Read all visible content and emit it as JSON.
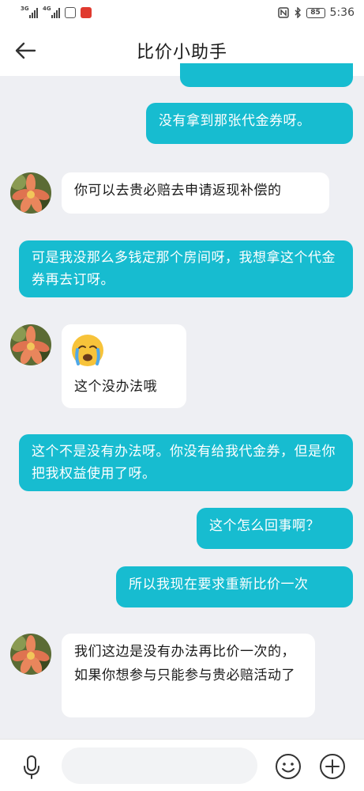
{
  "status_bar": {
    "network_1": "3G",
    "network_2": "4G",
    "battery": "85",
    "time": "5:36"
  },
  "header": {
    "title": "比价小助手"
  },
  "messages": [
    {
      "from": "me",
      "text": "没有拿到那张代金券呀。"
    },
    {
      "from": "bot",
      "text": "你可以去贵必赔去申请返现补偿的"
    },
    {
      "from": "me",
      "text": "可是我没那么多钱定那个房间呀，我想拿这个代金券再去订呀。"
    },
    {
      "from": "bot",
      "emoji": "😭",
      "text": "这个没办法哦"
    },
    {
      "from": "me",
      "text": "这个不是没有办法呀。你没有给我代金券，但是你把我权益使用了呀。"
    },
    {
      "from": "me",
      "text": "这个怎么回事啊？"
    },
    {
      "from": "me",
      "text": "所以我现在要求重新比价一次"
    },
    {
      "from": "bot",
      "text": "我们这边是没有办法再比价一次的，如果你想参与只能参与贵必赔活动了"
    }
  ],
  "input_bar": {
    "placeholder": ""
  },
  "colors": {
    "outgoing_bubble": "#17bcd0",
    "incoming_bubble": "#ffffff",
    "background": "#eeeff3"
  }
}
